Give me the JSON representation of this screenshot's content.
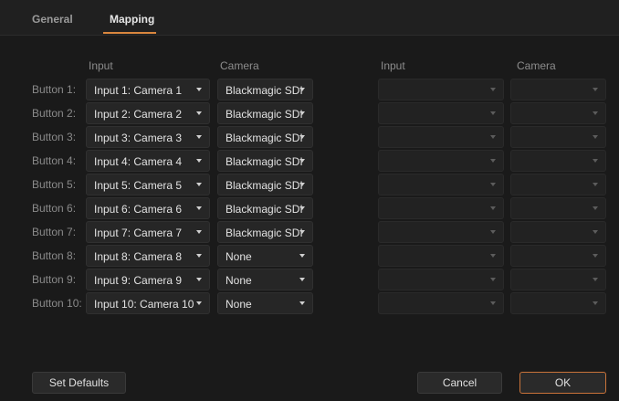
{
  "tabs": {
    "general": "General",
    "mapping": "Mapping"
  },
  "headers": {
    "input_left": "Input",
    "camera_left": "Camera",
    "input_right": "Input",
    "camera_right": "Camera"
  },
  "rows": [
    {
      "label": "Button 1:",
      "input": "Input 1: Camera 1",
      "camera": "Blackmagic SDI"
    },
    {
      "label": "Button 2:",
      "input": "Input 2: Camera 2",
      "camera": "Blackmagic SDI"
    },
    {
      "label": "Button 3:",
      "input": "Input 3: Camera 3",
      "camera": "Blackmagic SDI"
    },
    {
      "label": "Button 4:",
      "input": "Input 4: Camera 4",
      "camera": "Blackmagic SDI"
    },
    {
      "label": "Button 5:",
      "input": "Input 5: Camera 5",
      "camera": "Blackmagic SDI"
    },
    {
      "label": "Button 6:",
      "input": "Input 6: Camera 6",
      "camera": "Blackmagic SDI"
    },
    {
      "label": "Button 7:",
      "input": "Input 7: Camera 7",
      "camera": "Blackmagic SDI"
    },
    {
      "label": "Button 8:",
      "input": "Input 8: Camera 8",
      "camera": "None"
    },
    {
      "label": "Button 9:",
      "input": "Input 9: Camera 9",
      "camera": "None"
    },
    {
      "label": "Button 10:",
      "input": "Input 10: Camera 10",
      "camera": "None"
    }
  ],
  "buttons": {
    "set_defaults": "Set Defaults",
    "cancel": "Cancel",
    "ok": "OK"
  },
  "colors": {
    "accent": "#d9863e",
    "background": "#1a1a1a"
  }
}
